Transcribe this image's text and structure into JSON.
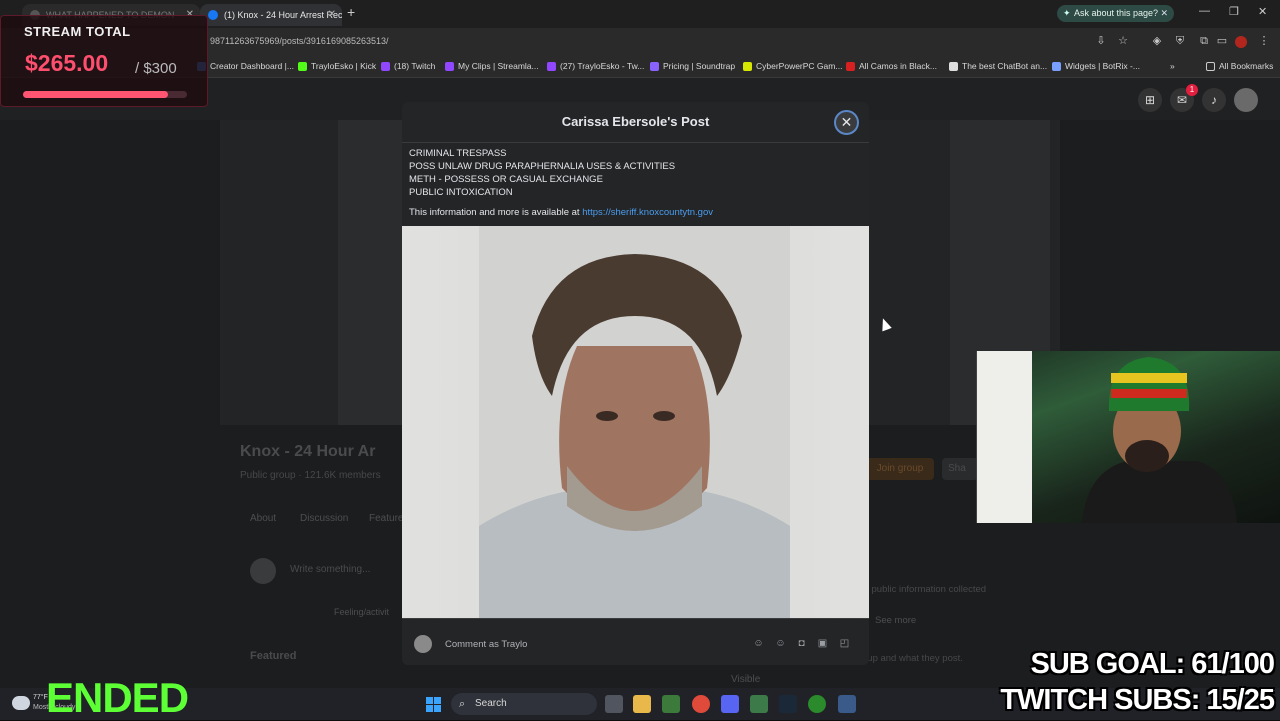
{
  "browser": {
    "tabs": [
      {
        "label": "WHAT HAPPENED TO DEMON"
      },
      {
        "label": "(1) Knox - 24 Hour Arrest Reco"
      }
    ],
    "ask_pill": "Ask about this page?",
    "url": "987112636759​69/posts/3916169085263513/",
    "bookmarks": [
      {
        "label": "Creator Dashboard |...",
        "color": "#3a7bd5"
      },
      {
        "label": "TrayloEsko | Kick",
        "color": "#53fc18"
      },
      {
        "label": "(18) Twitch",
        "color": "#9146ff"
      },
      {
        "label": "My Clips | Streamla...",
        "color": "#9146ff"
      },
      {
        "label": "(27) TrayloEsko - Tw...",
        "color": "#9146ff"
      },
      {
        "label": "Pricing | Soundtrap",
        "color": "#8a63ff"
      },
      {
        "label": "CyberPowerPC Gam...",
        "color": "#d7e600"
      },
      {
        "label": "All Camos in Black...",
        "color": "#d72020"
      },
      {
        "label": "The best ChatBot an...",
        "color": "#dddddd"
      },
      {
        "label": "Widgets | BotRix -...",
        "color": "#7aa0ff"
      }
    ],
    "all_bookmarks": "All Bookmarks"
  },
  "stream_total": {
    "title": "STREAM TOTAL",
    "amount": "$265.00",
    "goal": "/ $300",
    "progress": 0.8833
  },
  "fb": {
    "messenger_badge": "1",
    "group_title": "Knox - 24 Hour Ar",
    "group_meta": "Public group · 121.6K members",
    "group_tabs": [
      "About",
      "Discussion",
      "Feature"
    ],
    "join_label": "Join group",
    "share_label": "Sha",
    "write_placeholder": "Write something...",
    "feeling_label": "Feeling/activit",
    "featured_label": "Featured",
    "about_text": "is public information collected",
    "see_more": "See more",
    "about_text2": "oup and what they post.",
    "visible_label": "Visible"
  },
  "modal": {
    "title": "Carissa Ebersole's Post",
    "charges": [
      "CRIMINAL TRESPASS",
      "POSS UNLAW DRUG PARAPHERNALIA USES & ACTIVITIES",
      "METH - POSSESS OR CASUAL EXCHANGE",
      "PUBLIC INTOXICATION"
    ],
    "info_prefix": "This information and more is available at ",
    "info_link": "https://sheriff.knoxcountytn.gov",
    "comment_placeholder": "Comment as Traylo"
  },
  "taskbar": {
    "temp": "77°F",
    "weather": "Mostly cloudy",
    "search_label": "Search"
  },
  "overlays": {
    "ended": "ENDED",
    "sub_goal": "SUB GOAL: 61/100",
    "twitch_subs": "TWITCH SUBS: 15/25"
  }
}
